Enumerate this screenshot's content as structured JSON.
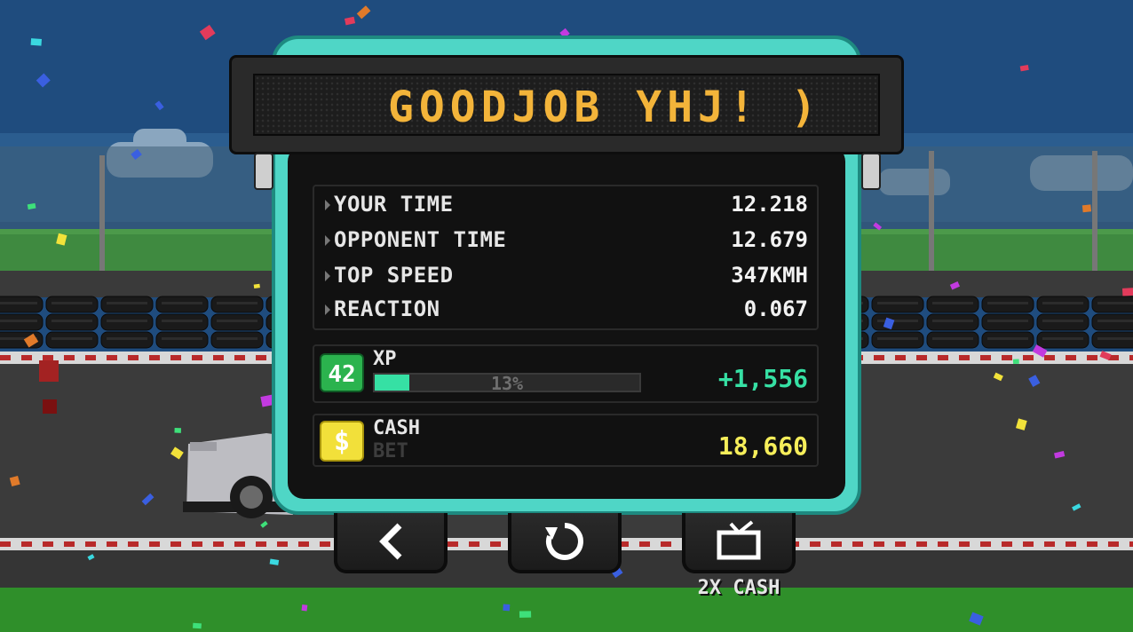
{
  "marquee": {
    "text": "GOODJOB YHJ! )"
  },
  "stats": [
    {
      "label": "YOUR TIME",
      "value": "12.218"
    },
    {
      "label": "OPPONENT TIME",
      "value": "12.679"
    },
    {
      "label": "TOP SPEED",
      "value": "347KMH"
    },
    {
      "label": "REACTION",
      "value": "0.067"
    }
  ],
  "xp": {
    "level": "42",
    "label": "XP",
    "progress": 0.13,
    "progress_text": "13%",
    "gain": "+1,556"
  },
  "cash": {
    "icon": "dollar-coin-icon",
    "label": "CASH",
    "sublabel": "BET",
    "amount": "18,660"
  },
  "buttons": {
    "back": {
      "icon": "back-arrow-icon"
    },
    "restart": {
      "icon": "restart-icon"
    },
    "double_cash": {
      "icon": "tv-ad-icon",
      "label": "2X CASH"
    }
  },
  "colors": {
    "panel_border": "#4fd6c6",
    "xp_accent": "#36e0a4",
    "cash_accent": "#f6ee5a",
    "marquee_text": "#f3b43a"
  }
}
